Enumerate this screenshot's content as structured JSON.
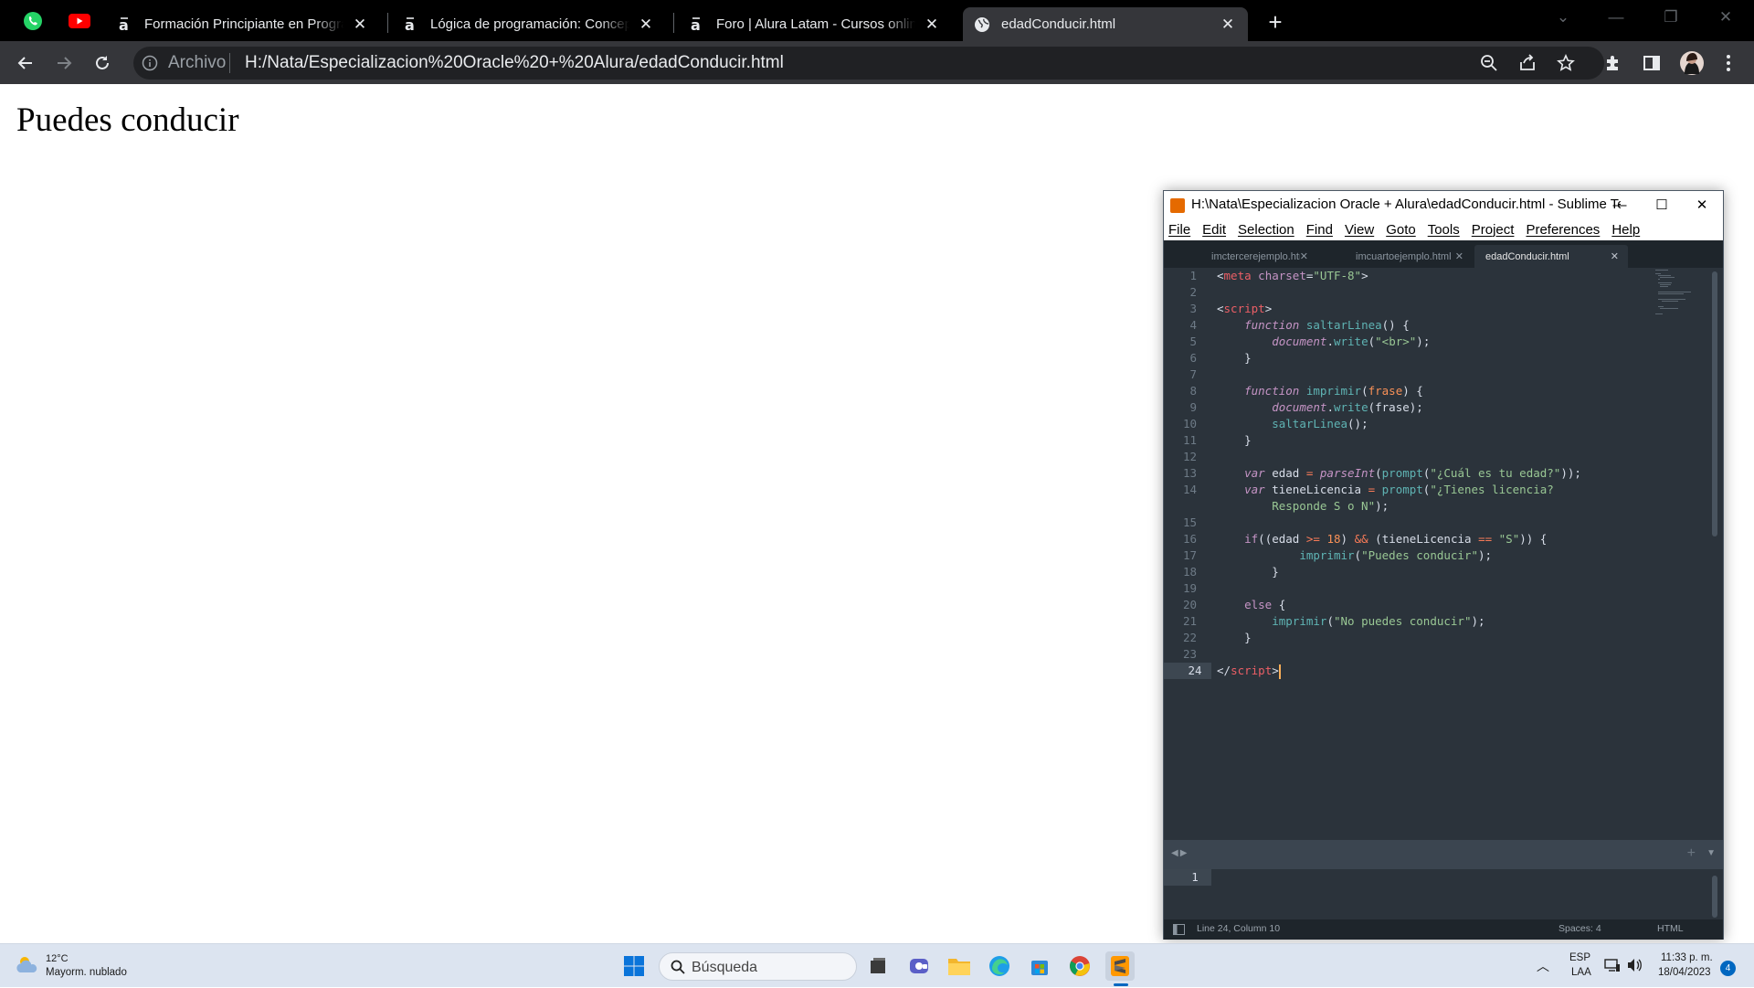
{
  "browser": {
    "tabs": [
      {
        "title": "Formación Principiante en Programación",
        "icon": "alura-icon"
      },
      {
        "title": "Lógica de programación: Conceptos primarios",
        "icon": "alura-icon"
      },
      {
        "title": "Foro | Alura Latam - Cursos online de tecnología",
        "icon": "alura-icon"
      },
      {
        "title": "edadConducir.html",
        "icon": "globe-icon",
        "active": true
      }
    ],
    "pinned": [
      "whatsapp-icon",
      "youtube-icon"
    ],
    "address": {
      "chip": "Archivo",
      "url": "H:/Nata/Especializacion%20Oracle%20+%20Alura/edadConducir.html"
    }
  },
  "page": {
    "heading": "Puedes conducir"
  },
  "sublime": {
    "title": "H:\\Nata\\Especializacion Oracle + Alura\\edadConducir.html - Sublime Text (UNREGISTERED)",
    "menu": [
      "File",
      "Edit",
      "Selection",
      "Find",
      "View",
      "Goto",
      "Tools",
      "Project",
      "Preferences",
      "Help"
    ],
    "tabs": [
      {
        "name": "imctercerejemplo.html",
        "active": false
      },
      {
        "name": "imcuartoejemplo.html",
        "active": false
      },
      {
        "name": "edadConducir.html",
        "active": true
      }
    ],
    "line_numbers": [
      "1",
      "2",
      "3",
      "4",
      "5",
      "6",
      "7",
      "8",
      "9",
      "10",
      "11",
      "12",
      "13",
      "14",
      "",
      "15",
      "16",
      "17",
      "18",
      "19",
      "20",
      "21",
      "22",
      "23",
      "24"
    ],
    "current_line": "24",
    "panel_line": "1",
    "status": {
      "position": "Line 24, Column 10",
      "spaces": "Spaces: 4",
      "syntax": "HTML"
    }
  },
  "taskbar": {
    "weather": {
      "temp": "12°C",
      "desc": "Mayorm. nublado"
    },
    "search_placeholder": "Búsqueda",
    "apps": [
      "windows-start-icon",
      "file-explorer-icon",
      "teams-icon",
      "folder-icon",
      "edge-icon",
      "store-icon",
      "chrome-icon",
      "sublime-icon"
    ],
    "lang": "ESP",
    "layout": "LAA",
    "time": "11:33 p. m.",
    "date": "18/04/2023",
    "notifications": "4"
  },
  "colors": {
    "chrome_dark": "#000000",
    "chrome_toolbar": "#35363a",
    "sublime_bg": "#2b333b",
    "accent": "#0067c0"
  }
}
